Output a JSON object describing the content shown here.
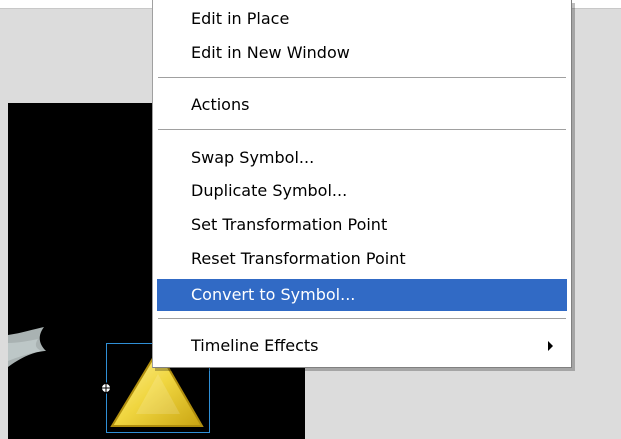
{
  "context_menu": {
    "items": [
      {
        "label": "Edit in Place"
      },
      {
        "label": "Edit in New Window"
      },
      {
        "label": "Actions"
      },
      {
        "label": "Swap Symbol..."
      },
      {
        "label": "Duplicate Symbol..."
      },
      {
        "label": "Set Transformation Point"
      },
      {
        "label": "Reset Transformation Point"
      },
      {
        "label": "Convert to Symbol...",
        "highlighted": true
      },
      {
        "label": "Timeline Effects",
        "has_submenu": true
      }
    ]
  },
  "colors": {
    "highlight": "#316ac5",
    "stage": "#000000",
    "selection_border": "#2f8fd6",
    "triangle_fill": "#f0d640"
  },
  "icons": {
    "submenu": "submenu-arrow-icon",
    "registration": "registration-point-icon"
  }
}
